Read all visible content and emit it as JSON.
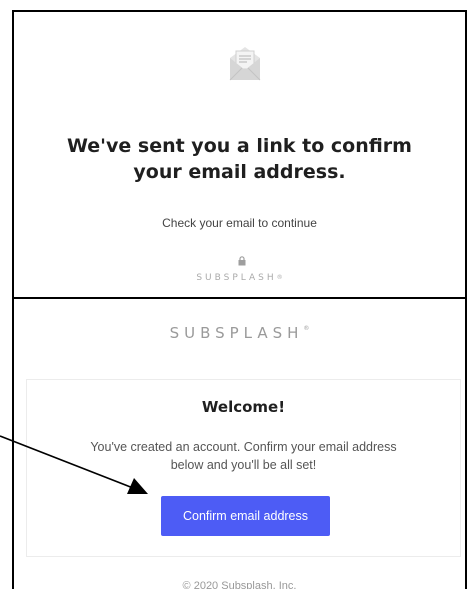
{
  "top_panel": {
    "icon": "envelope-letter-icon",
    "headline_line1": "We've sent you a link to confirm",
    "headline_line2": "your email address.",
    "subtext": "Check your email to continue",
    "lock_icon": "lock-icon",
    "brand": "SUBSPLASH",
    "brand_mark": "®"
  },
  "bottom_panel": {
    "brand": "SUBSPLASH",
    "brand_mark": "®",
    "card": {
      "title": "Welcome!",
      "body_line1": "You've created an account. Confirm your email address",
      "body_line2": "below and you'll be all set!",
      "button_label": "Confirm email address"
    },
    "footer": "© 2020 Subsplash, Inc."
  },
  "colors": {
    "button_bg": "#4d5cf5",
    "button_text": "#ffffff",
    "headline": "#1f1f1f",
    "brand": "#9a9a9a",
    "icon": "#d9d9d9"
  },
  "annotation": {
    "type": "arrow",
    "color": "#000000"
  }
}
